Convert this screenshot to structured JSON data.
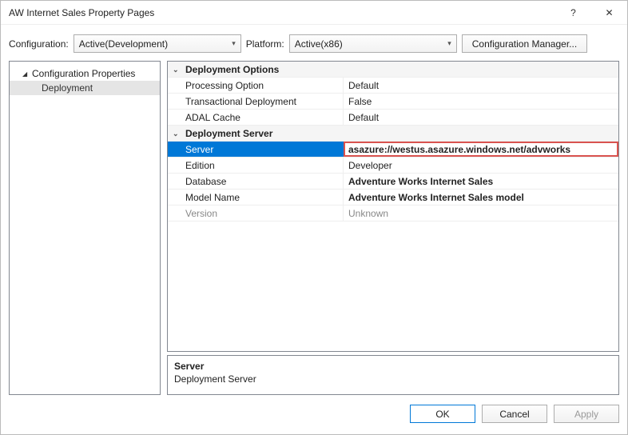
{
  "window": {
    "title": "AW Internet Sales Property Pages",
    "help_glyph": "?",
    "close_glyph": "✕"
  },
  "config": {
    "label": "Configuration:",
    "value": "Active(Development)",
    "platform_label": "Platform:",
    "platform_value": "Active(x86)",
    "manager_btn": "Configuration Manager..."
  },
  "tree": {
    "parent": "Configuration Properties",
    "child": "Deployment"
  },
  "grid": {
    "cat1": "Deployment Options",
    "rows1": [
      {
        "name": "Processing Option",
        "value": "Default"
      },
      {
        "name": "Transactional Deployment",
        "value": "False"
      },
      {
        "name": "ADAL Cache",
        "value": "Default"
      }
    ],
    "cat2": "Deployment Server",
    "rows2": [
      {
        "name": "Server",
        "value": "asazure://westus.asazure.windows.net/advworks",
        "selected": true,
        "boldval": true
      },
      {
        "name": "Edition",
        "value": "Developer"
      },
      {
        "name": "Database",
        "value": "Adventure Works Internet Sales",
        "boldval": true
      },
      {
        "name": "Model Name",
        "value": "Adventure Works Internet Sales model",
        "boldval": true
      },
      {
        "name": "Version",
        "value": "Unknown",
        "dim": true
      }
    ]
  },
  "desc": {
    "title": "Server",
    "text": "Deployment Server"
  },
  "footer": {
    "ok": "OK",
    "cancel": "Cancel",
    "apply": "Apply"
  }
}
